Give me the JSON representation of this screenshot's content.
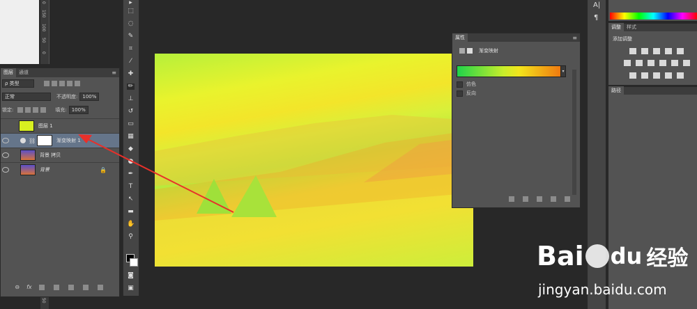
{
  "ruler": {
    "top_numbers": [
      "0",
      "150",
      "100",
      "50",
      "0"
    ],
    "bottom_numbers": [
      "50"
    ]
  },
  "layers_panel": {
    "tabs": [
      "图层",
      "通道"
    ],
    "kind_label": "ρ 类型",
    "blend_mode": "正常",
    "opacity_label": "不透明度:",
    "opacity_value": "100%",
    "lock_label": "锁定:",
    "fill_label": "填充:",
    "fill_value": "100%",
    "layers": [
      {
        "name": "图层 1"
      },
      {
        "name": "渐变映射 1"
      },
      {
        "name": "背景 拷贝"
      },
      {
        "name": "背景"
      }
    ]
  },
  "properties_panel": {
    "title": "属性",
    "adjustment_name": "渐变映射",
    "dither_label": "仿色",
    "reverse_label": "反向"
  },
  "adjustments_panel": {
    "tabs": [
      "调整",
      "样式"
    ],
    "heading": "添加调整"
  },
  "paths_panel": {
    "tab": "路径"
  },
  "right_column": {
    "char_icon": "A|",
    "para_icon": "¶"
  },
  "watermark": {
    "brand": "Bai",
    "brand_suffix": "du",
    "cn": "经验",
    "url": "jingyan.baidu.com"
  },
  "colors": {
    "arrow": "#e8302a",
    "gradient_start": "#1fd24a",
    "gradient_end": "#f07a10"
  }
}
